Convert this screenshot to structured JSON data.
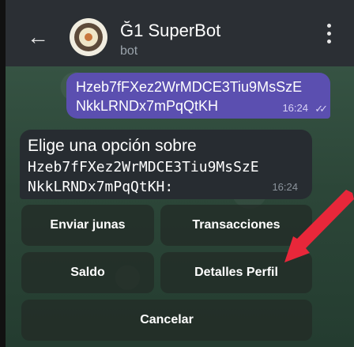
{
  "header": {
    "back_icon": "arrow-left-icon",
    "title": "Ğ1 SuperBot",
    "subtitle": "bot",
    "menu_icon": "more-vertical-icon"
  },
  "outgoing": {
    "line1": "Hzeb7fFXez2WrMDCE3Tiu9MsSzE",
    "line2": "NkkLRNDx7mPqQtKH",
    "time": "16:24",
    "ticks": "✓✓"
  },
  "incoming": {
    "line1": "Elige una opción sobre",
    "line2": "Hzeb7fFXez2WrMDCE3Tiu9MsSzE",
    "line3": "NkkLRNDx7mPqQtKH:",
    "time": "16:24"
  },
  "buttons": {
    "send": "Enviar junas",
    "transactions": "Transacciones",
    "balance": "Saldo",
    "profile": "Detalles Perfil",
    "cancel": "Cancelar"
  },
  "colors": {
    "header_bg": "#2b2f34",
    "outgoing_bubble": "#5b4fb0",
    "incoming_bubble": "#272c31",
    "annotation_arrow": "#e8273a"
  }
}
